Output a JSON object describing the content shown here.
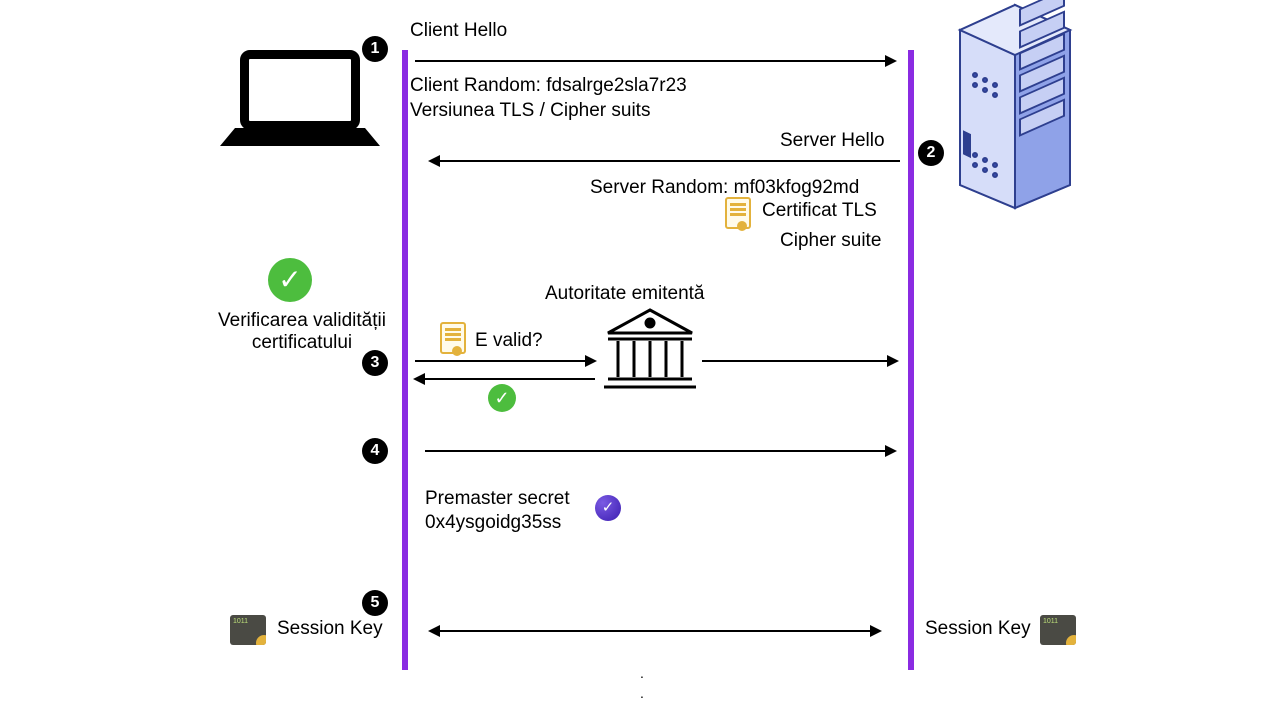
{
  "steps": {
    "s1": "1",
    "s2": "2",
    "s3": "3",
    "s4": "4",
    "s5": "5"
  },
  "client": {
    "hello": "Client Hello",
    "random": "Client Random: fdsalrge2sla7r23",
    "version": "Versiunea TLS / Cipher suits"
  },
  "server": {
    "hello": "Server Hello",
    "random": "Server Random: mf03kfog92md",
    "cert": "Certificat TLS",
    "cipher": "Cipher suite"
  },
  "validation": {
    "title": "Verificarea validității\ncertificatului",
    "question": "E valid?",
    "authority": "Autoritate emitentă"
  },
  "premaster": {
    "label": "Premaster secret",
    "value": "0x4ysgoidg35ss"
  },
  "session": {
    "left": "Session Key",
    "right": "Session Key"
  }
}
